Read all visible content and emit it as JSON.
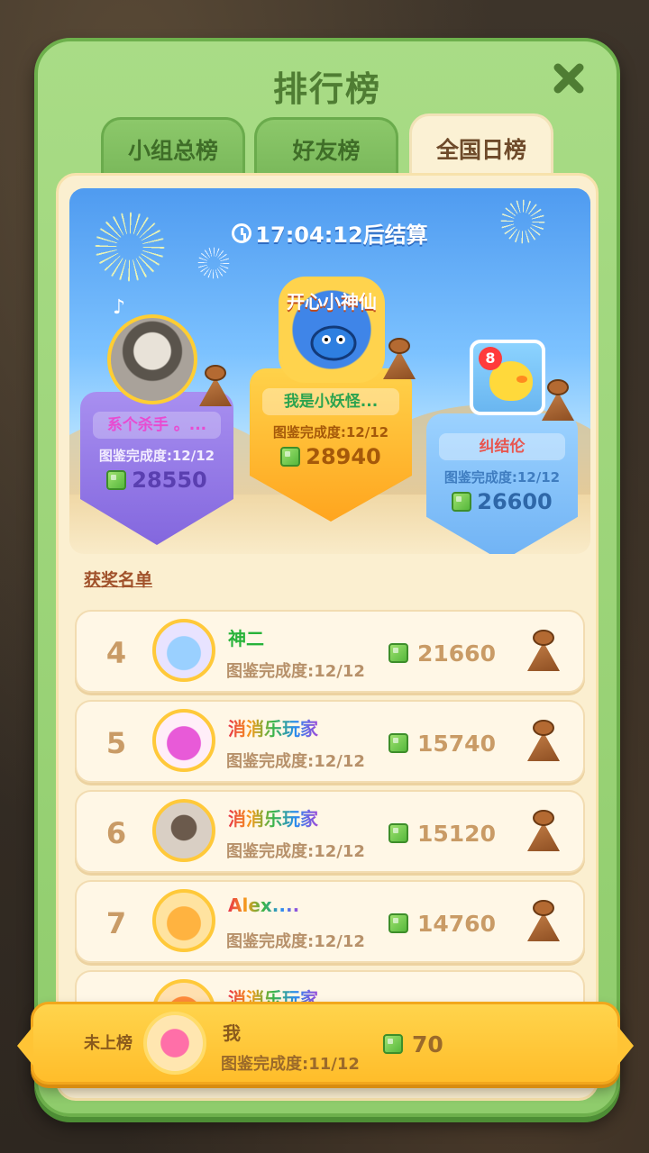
{
  "title": "排行榜",
  "tabs": [
    {
      "label": "小组总榜",
      "active": false
    },
    {
      "label": "好友榜",
      "active": false
    },
    {
      "label": "全国日榜",
      "active": true
    }
  ],
  "timer": "17:04:12后结算",
  "podium": {
    "first": {
      "badge_text": "开心小神仙",
      "name": "我是小妖怪...",
      "progress": "图鉴完成度:12/12",
      "score": "28940"
    },
    "second": {
      "name": "系个杀手 。...",
      "progress": "图鉴完成度:12/12",
      "score": "28550"
    },
    "third": {
      "badge": "8",
      "name": "纠结伦",
      "progress": "图鉴完成度:12/12",
      "score": "26600"
    }
  },
  "section_label": "获奖名单",
  "rows": [
    {
      "rank": "4",
      "name": "神二",
      "progress": "图鉴完成度:12/12",
      "score": "21660"
    },
    {
      "rank": "5",
      "name": "消消乐玩家",
      "progress": "图鉴完成度:12/12",
      "score": "15740"
    },
    {
      "rank": "6",
      "name": "消消乐玩家",
      "progress": "图鉴完成度:12/12",
      "score": "15120"
    },
    {
      "rank": "7",
      "name": "Alex....",
      "progress": "图鉴完成度:12/12",
      "score": "14760"
    },
    {
      "rank": "",
      "name": "消消乐玩家",
      "progress": "",
      "score": ""
    }
  ],
  "me": {
    "rank": "未上榜",
    "name": "我",
    "progress": "图鉴完成度:11/12",
    "score": "70"
  },
  "icons": {
    "close": "close-icon",
    "clock": "clock-icon",
    "score": "green-block-icon",
    "reward": "raccoon-cloak-icon"
  },
  "colors": {
    "panel": "#a9dc86",
    "tab_active": "#fbf1d4",
    "gold": "#ffc93a",
    "second_shield": "#8367de",
    "first_shield": "#ffa51e",
    "third_shield": "#6fb2f4"
  }
}
